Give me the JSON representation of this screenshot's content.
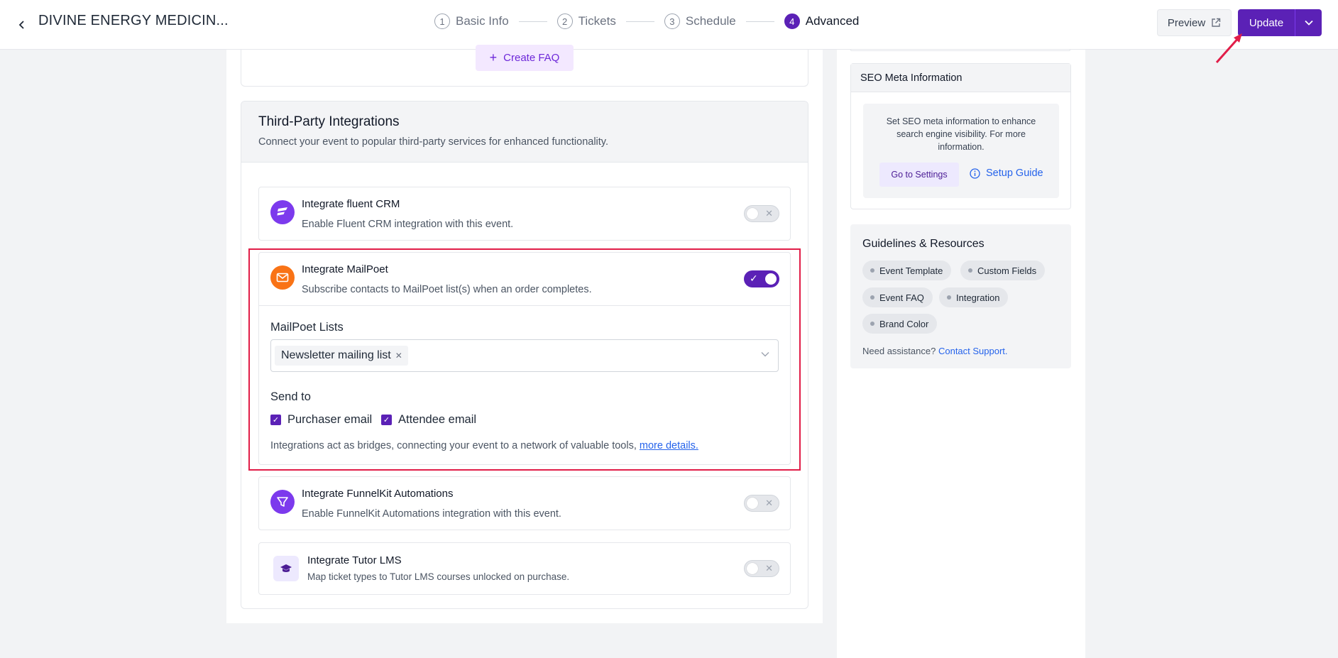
{
  "header": {
    "event_title": "DIVINE ENERGY MEDICIN...",
    "steps": [
      {
        "num": "1",
        "label": "Basic Info"
      },
      {
        "num": "2",
        "label": "Tickets"
      },
      {
        "num": "3",
        "label": "Schedule"
      },
      {
        "num": "4",
        "label": "Advanced"
      }
    ],
    "active_step": 4,
    "preview_label": "Preview",
    "update_label": "Update"
  },
  "faq": {
    "create_label": "Create FAQ"
  },
  "integrations": {
    "title": "Third-Party Integrations",
    "subtitle": "Connect your event to popular third-party services for enhanced functionality.",
    "fluent_crm": {
      "title": "Integrate fluent CRM",
      "desc": "Enable Fluent CRM integration with this event.",
      "enabled": false
    },
    "mailpoet": {
      "title": "Integrate MailPoet",
      "desc": "Subscribe contacts to MailPoet list(s) when an order completes.",
      "enabled": true,
      "lists_label": "MailPoet Lists",
      "selected_list": "Newsletter mailing list",
      "send_to_label": "Send to",
      "purchaser_label": "Purchaser email",
      "purchaser_checked": true,
      "attendee_label": "Attendee email",
      "attendee_checked": true,
      "note": "Integrations act as bridges, connecting your event to a network of valuable tools,",
      "note_link": "more details."
    },
    "funnelkit": {
      "title": "Integrate FunnelKit Automations",
      "desc": "Enable FunnelKit Automations integration with this event.",
      "enabled": false
    },
    "tutor": {
      "title": "Integrate Tutor LMS",
      "desc": "Map ticket types to Tutor LMS courses unlocked on purchase.",
      "enabled": false
    }
  },
  "seo": {
    "title": "SEO Meta Information",
    "text": "Set SEO meta information to enhance search engine visibility. For more information.",
    "settings_label": "Go to Settings",
    "guide_label": "Setup Guide"
  },
  "guidelines": {
    "title": "Guidelines & Resources",
    "chips": [
      "Event Template",
      "Custom Fields",
      "Event FAQ",
      "Integration",
      "Brand Color"
    ],
    "assist_text": "Need assistance?",
    "assist_link": "Contact Support."
  },
  "colors": {
    "accent": "#5b21b6",
    "highlight": "#e11d48",
    "link": "#2563eb"
  }
}
